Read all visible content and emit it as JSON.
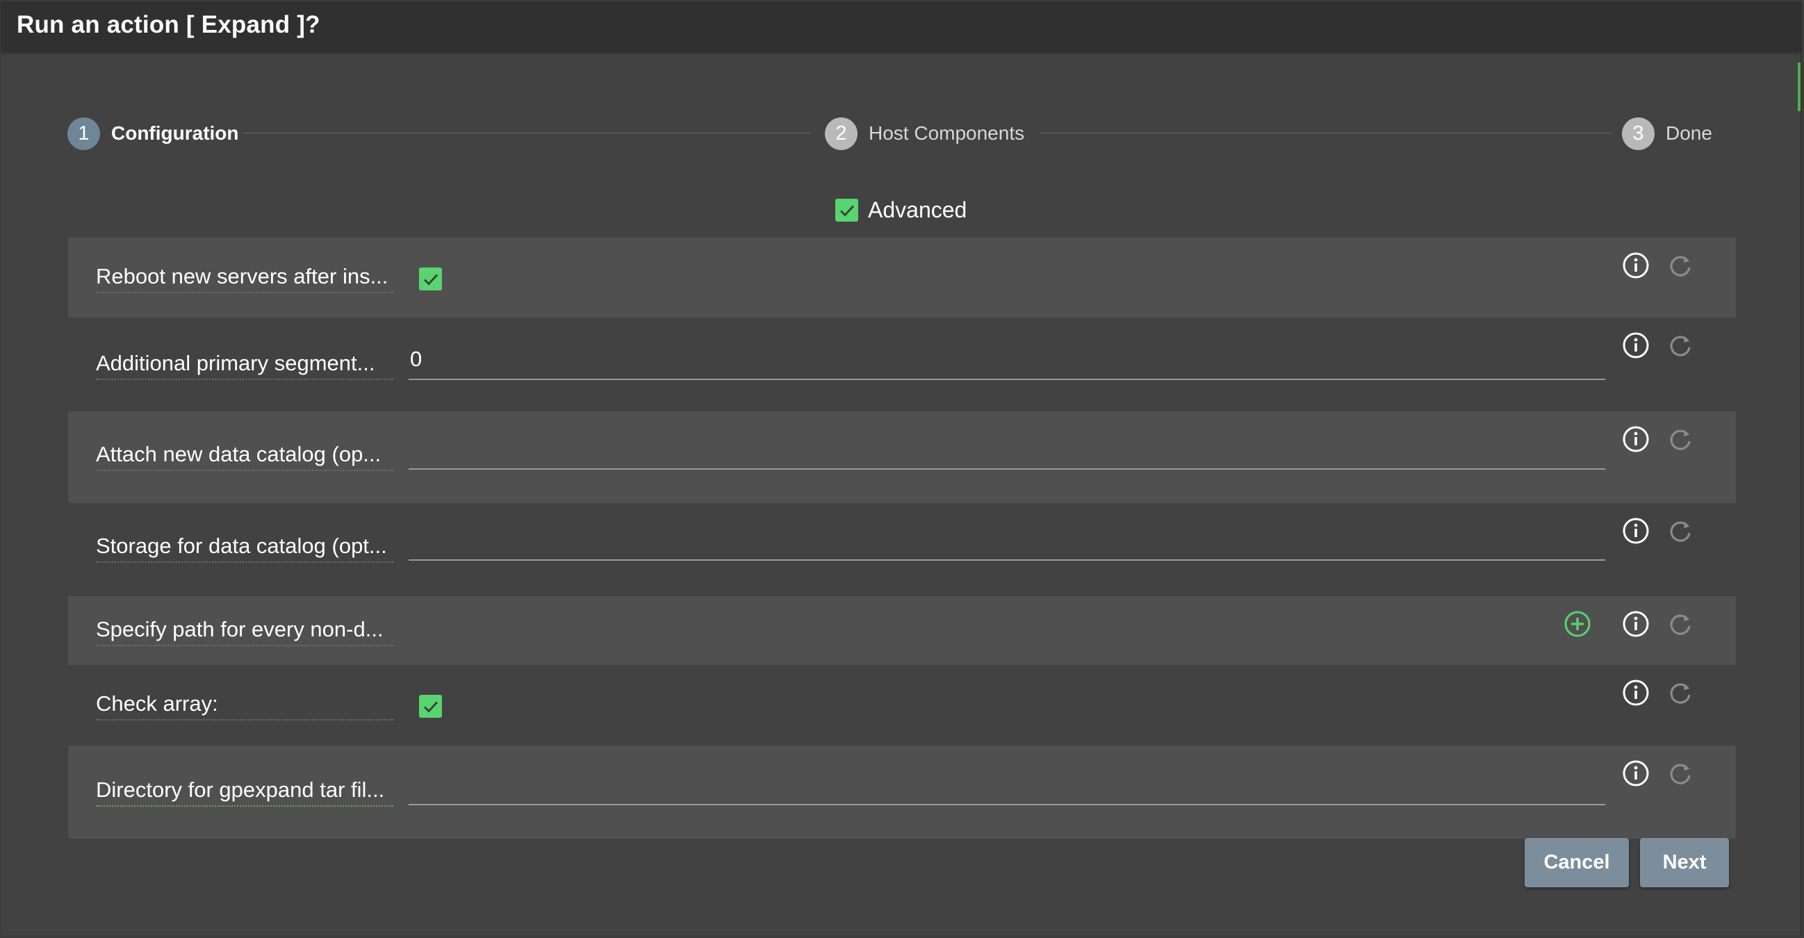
{
  "dialog": {
    "title": "Run an action [ Expand ]?"
  },
  "stepper": {
    "steps": [
      {
        "number": "1",
        "label": "Configuration",
        "state": "active"
      },
      {
        "number": "2",
        "label": "Host Components",
        "state": "inactive"
      },
      {
        "number": "3",
        "label": "Done",
        "state": "inactive"
      }
    ]
  },
  "advanced": {
    "label": "Advanced",
    "checked": true
  },
  "fields": [
    {
      "label": "Reboot new servers after ins...",
      "type": "checkbox",
      "checked": true
    },
    {
      "label": "Additional primary segment...",
      "type": "text",
      "value": "0"
    },
    {
      "label": "Attach new data catalog (op...",
      "type": "text",
      "value": ""
    },
    {
      "label": "Storage for data catalog (opt...",
      "type": "text",
      "value": ""
    },
    {
      "label": "Specify path for every non-d...",
      "type": "list",
      "value": ""
    },
    {
      "label": "Check array:",
      "type": "checkbox",
      "checked": true
    },
    {
      "label": "Directory for gpexpand tar fil...",
      "type": "text",
      "value": ""
    }
  ],
  "buttons": {
    "cancel": "Cancel",
    "next": "Next"
  },
  "colors": {
    "background": "#424242",
    "titlebar": "#303030",
    "row_alt": "#505050",
    "checkbox": "#5ad371",
    "add_icon": "#5ad371",
    "step_active": "#6f8598",
    "step_inactive": "#b9b9b9",
    "button": "#7c8d9b"
  },
  "icons": {
    "info": "info-circle-icon",
    "reset": "refresh-icon",
    "add": "plus-circle-icon",
    "check": "check-icon"
  }
}
